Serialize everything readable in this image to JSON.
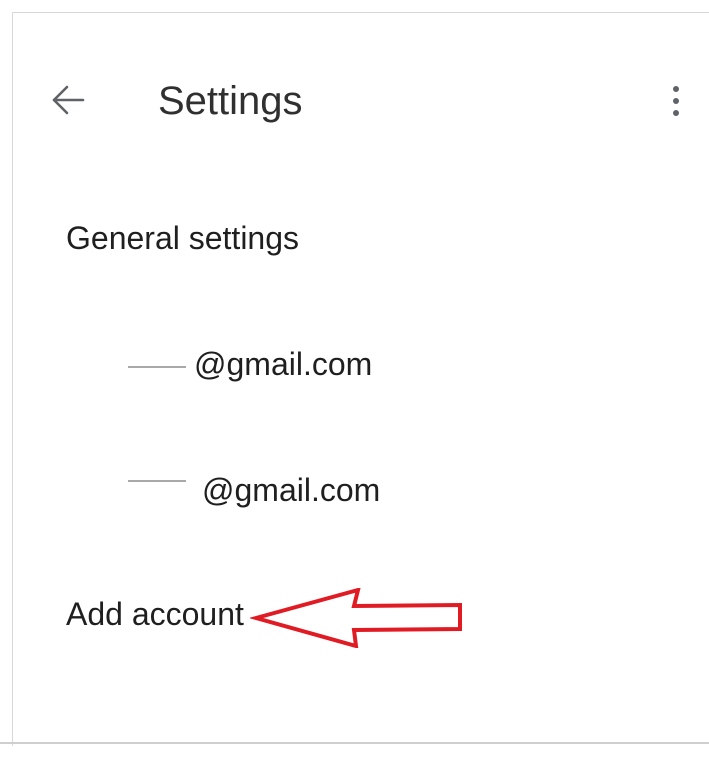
{
  "header": {
    "back_icon": "arrow-left-icon",
    "title": "Settings",
    "more_icon": "more-vert-icon"
  },
  "settings_list": {
    "general": "General settings",
    "accounts": [
      {
        "email_suffix": "@gmail.com"
      },
      {
        "email_suffix": "@gmail.com"
      }
    ],
    "add_account": "Add account"
  },
  "annotation": {
    "arrow_color": "#e01b24",
    "arrow_icon": "red-arrow-left-icon"
  }
}
